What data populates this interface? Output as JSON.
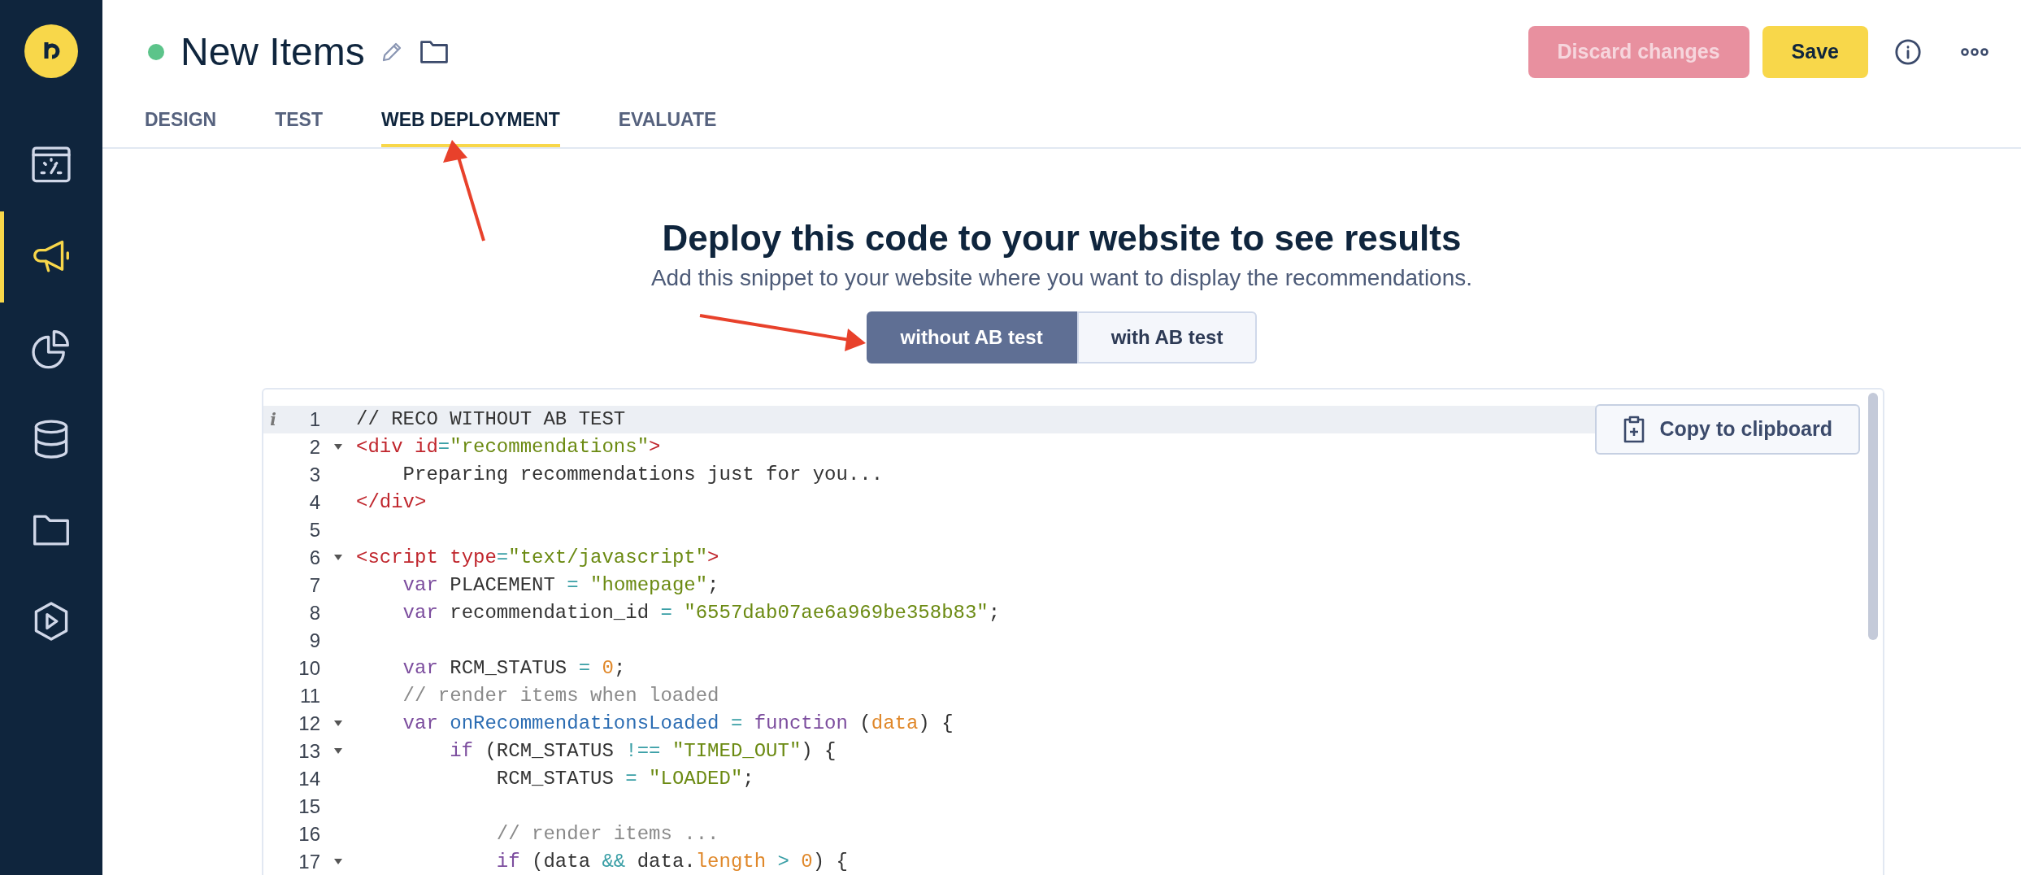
{
  "sidebar": {
    "items": [
      {
        "kind": "gauge",
        "selected": false
      },
      {
        "kind": "megaphone",
        "selected": true
      },
      {
        "kind": "pie",
        "selected": false
      },
      {
        "kind": "database",
        "selected": false
      },
      {
        "kind": "folder",
        "selected": false
      },
      {
        "kind": "play",
        "selected": false
      }
    ]
  },
  "header": {
    "title": "New Items",
    "buttons": [
      {
        "kind": "discard",
        "label": "Discard changes",
        "disabled": true
      },
      {
        "kind": "save",
        "label": "Save",
        "disabled": false
      }
    ]
  },
  "tabs": [
    {
      "label": "DESIGN",
      "selected": false
    },
    {
      "label": "TEST",
      "selected": false
    },
    {
      "label": "WEB DEPLOYMENT",
      "selected": true
    },
    {
      "label": "EVALUATE",
      "selected": false
    }
  ],
  "deploy": {
    "heading": "Deploy this code to your website to see results",
    "subtitle": "Add this snippet to your website where you want to display the recommendations.",
    "toggle": [
      {
        "label": "without AB test",
        "selected": true
      },
      {
        "label": "with AB test",
        "selected": false
      }
    ]
  },
  "editor": {
    "copy_button": "Copy to clipboard",
    "lines": [
      {
        "number": "1",
        "marker": "i",
        "foldable": false,
        "active": true,
        "tokens": [
          {
            "kind": "plain",
            "text": "// RECO WITHOUT AB TEST"
          }
        ]
      },
      {
        "number": "2",
        "foldable": true,
        "active": false,
        "tokens": [
          {
            "kind": "tag",
            "text": "<div"
          },
          {
            "kind": "attr",
            "text": " id"
          },
          {
            "kind": "op",
            "text": "="
          },
          {
            "kind": "string",
            "text": "\"recommendations\""
          },
          {
            "kind": "tag",
            "text": ">"
          }
        ]
      },
      {
        "number": "3",
        "foldable": false,
        "active": false,
        "tokens": [
          {
            "kind": "plain",
            "text": "    Preparing recommendations just for you..."
          }
        ]
      },
      {
        "number": "4",
        "foldable": false,
        "active": false,
        "tokens": [
          {
            "kind": "tag",
            "text": "</div>"
          }
        ]
      },
      {
        "number": "5",
        "foldable": false,
        "active": false
      },
      {
        "number": "6",
        "foldable": true,
        "active": false,
        "tokens": [
          {
            "kind": "tag",
            "text": "<script"
          },
          {
            "kind": "attr",
            "text": " type"
          },
          {
            "kind": "op",
            "text": "="
          },
          {
            "kind": "string",
            "text": "\"text/javascript\""
          },
          {
            "kind": "tag",
            "text": ">"
          }
        ]
      },
      {
        "number": "7",
        "foldable": false,
        "active": false,
        "tokens": [
          {
            "kind": "keyword",
            "text": "    var"
          },
          {
            "kind": "plain",
            "text": " PLACEMENT "
          },
          {
            "kind": "op",
            "text": "="
          },
          {
            "kind": "string",
            "text": " \"homepage\""
          },
          {
            "kind": "plain",
            "text": ";"
          }
        ]
      },
      {
        "number": "8",
        "foldable": false,
        "active": false,
        "tokens": [
          {
            "kind": "keyword",
            "text": "    var"
          },
          {
            "kind": "plain",
            "text": " recommendation_id "
          },
          {
            "kind": "op",
            "text": "="
          },
          {
            "kind": "string",
            "text": " \"6557dab07ae6a969be358b83\""
          },
          {
            "kind": "plain",
            "text": ";"
          }
        ]
      },
      {
        "number": "9",
        "foldable": false,
        "active": false
      },
      {
        "number": "10",
        "foldable": false,
        "active": false,
        "tokens": [
          {
            "kind": "keyword",
            "text": "    var"
          },
          {
            "kind": "plain",
            "text": " RCM_STATUS "
          },
          {
            "kind": "op",
            "text": "="
          },
          {
            "kind": "number",
            "text": " 0"
          },
          {
            "kind": "plain",
            "text": ";"
          }
        ]
      },
      {
        "number": "11",
        "foldable": false,
        "active": false,
        "tokens": [
          {
            "kind": "comment",
            "text": "    // render items when loaded"
          }
        ]
      },
      {
        "number": "12",
        "foldable": true,
        "active": false,
        "tokens": [
          {
            "kind": "keyword",
            "text": "    var"
          },
          {
            "kind": "function",
            "text": " onRecommendationsLoaded"
          },
          {
            "kind": "op",
            "text": " ="
          },
          {
            "kind": "keyword",
            "text": " function"
          },
          {
            "kind": "plain",
            "text": " ("
          },
          {
            "kind": "param",
            "text": "data"
          },
          {
            "kind": "plain",
            "text": ") {"
          }
        ]
      },
      {
        "number": "13",
        "foldable": true,
        "active": false,
        "tokens": [
          {
            "kind": "keyword",
            "text": "        if"
          },
          {
            "kind": "plain",
            "text": " (RCM_STATUS "
          },
          {
            "kind": "op",
            "text": "!=="
          },
          {
            "kind": "string",
            "text": " \"TIMED_OUT\""
          },
          {
            "kind": "plain",
            "text": ") {"
          }
        ]
      },
      {
        "number": "14",
        "foldable": false,
        "active": false,
        "tokens": [
          {
            "kind": "plain",
            "text": "            RCM_STATUS "
          },
          {
            "kind": "op",
            "text": "="
          },
          {
            "kind": "string",
            "text": " \"LOADED\""
          },
          {
            "kind": "plain",
            "text": ";"
          }
        ]
      },
      {
        "number": "15",
        "foldable": false,
        "active": false
      },
      {
        "number": "16",
        "foldable": false,
        "active": false,
        "tokens": [
          {
            "kind": "comment",
            "text": "            // render items ..."
          }
        ]
      },
      {
        "number": "17",
        "foldable": true,
        "active": false,
        "tokens": [
          {
            "kind": "keyword",
            "text": "            if"
          },
          {
            "kind": "plain",
            "text": " (data "
          },
          {
            "kind": "op",
            "text": "&&"
          },
          {
            "kind": "plain",
            "text": " data."
          },
          {
            "kind": "param",
            "text": "length"
          },
          {
            "kind": "op",
            "text": " >"
          },
          {
            "kind": "number",
            "text": " 0"
          },
          {
            "kind": "plain",
            "text": ") {"
          }
        ]
      }
    ]
  }
}
